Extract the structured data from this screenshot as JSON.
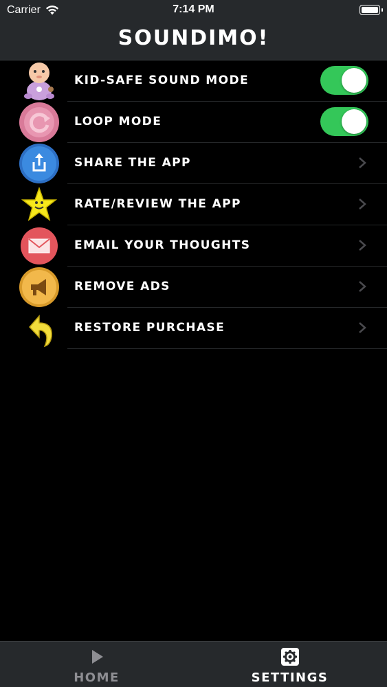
{
  "status_bar": {
    "carrier": "Carrier",
    "time": "7:14 PM",
    "icons": [
      "wifi-icon",
      "battery-icon"
    ]
  },
  "nav": {
    "title": "SOUNDIMO!"
  },
  "settings": {
    "items": [
      {
        "label": "KID-SAFE SOUND MODE",
        "icon": "baby-icon",
        "control": "toggle",
        "toggle_on": true
      },
      {
        "label": "LOOP MODE",
        "icon": "loop-icon",
        "control": "toggle",
        "toggle_on": true
      },
      {
        "label": "SHARE THE APP",
        "icon": "share-icon",
        "control": "chevron"
      },
      {
        "label": "RATE/REVIEW THE APP",
        "icon": "star-icon",
        "control": "chevron"
      },
      {
        "label": "EMAIL YOUR THOUGHTS",
        "icon": "envelope-icon",
        "control": "chevron"
      },
      {
        "label": "REMOVE ADS",
        "icon": "megaphone-icon",
        "control": "chevron"
      },
      {
        "label": "RESTORE PURCHASE",
        "icon": "undo-arrow-icon",
        "control": "chevron"
      }
    ]
  },
  "tab_bar": {
    "tabs": [
      {
        "label": "HOME",
        "icon": "play-icon",
        "selected": false
      },
      {
        "label": "SETTINGS",
        "icon": "gear-icon",
        "selected": true
      }
    ]
  },
  "colors": {
    "background": "#000000",
    "bar_background": "#26292c",
    "toggle_on": "#34c759",
    "chevron": "#4a4a4e",
    "tab_inactive": "#8e8e93",
    "tab_active": "#ffffff"
  }
}
